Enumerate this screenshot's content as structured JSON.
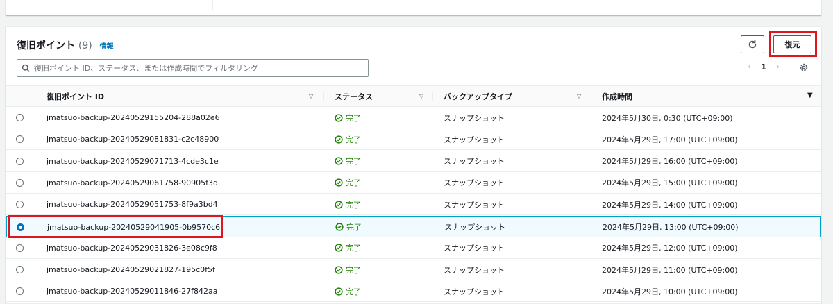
{
  "section": {
    "title": "復旧ポイント",
    "count": "(9)",
    "info_link": "情報",
    "restore_label": "復元",
    "search_placeholder": "復旧ポイント ID、ステータス、または作成時間でフィルタリング",
    "page": "1"
  },
  "columns": [
    "復旧ポイント ID",
    "ステータス",
    "バックアップタイプ",
    "作成時間"
  ],
  "rows": [
    {
      "id": "jmatsuo-backup-20240529155204-288a02e6",
      "status": "完了",
      "type": "スナップショット",
      "created": "2024年5月30日, 0:30 (UTC+09:00)",
      "selected": false
    },
    {
      "id": "jmatsuo-backup-20240529081831-c2c48900",
      "status": "完了",
      "type": "スナップショット",
      "created": "2024年5月29日, 17:00 (UTC+09:00)",
      "selected": false
    },
    {
      "id": "jmatsuo-backup-20240529071713-4cde3c1e",
      "status": "完了",
      "type": "スナップショット",
      "created": "2024年5月29日, 16:00 (UTC+09:00)",
      "selected": false
    },
    {
      "id": "jmatsuo-backup-20240529061758-90905f3d",
      "status": "完了",
      "type": "スナップショット",
      "created": "2024年5月29日, 15:00 (UTC+09:00)",
      "selected": false
    },
    {
      "id": "jmatsuo-backup-20240529051753-8f9a3bd4",
      "status": "完了",
      "type": "スナップショット",
      "created": "2024年5月29日, 14:00 (UTC+09:00)",
      "selected": false
    },
    {
      "id": "jmatsuo-backup-20240529041905-0b9570c6",
      "status": "完了",
      "type": "スナップショット",
      "created": "2024年5月29日, 13:00 (UTC+09:00)",
      "selected": true
    },
    {
      "id": "jmatsuo-backup-20240529031826-3e08c9f8",
      "status": "完了",
      "type": "スナップショット",
      "created": "2024年5月29日, 12:00 (UTC+09:00)",
      "selected": false
    },
    {
      "id": "jmatsuo-backup-20240529021827-195c0f5f",
      "status": "完了",
      "type": "スナップショット",
      "created": "2024年5月29日, 11:00 (UTC+09:00)",
      "selected": false
    },
    {
      "id": "jmatsuo-backup-20240529011846-27f842aa",
      "status": "完了",
      "type": "スナップショット",
      "created": "2024年5月29日, 10:00 (UTC+09:00)",
      "selected": false
    }
  ],
  "colors": {
    "accent": "#0073bb",
    "success": "#1d8102",
    "highlight": "#e0161e"
  }
}
